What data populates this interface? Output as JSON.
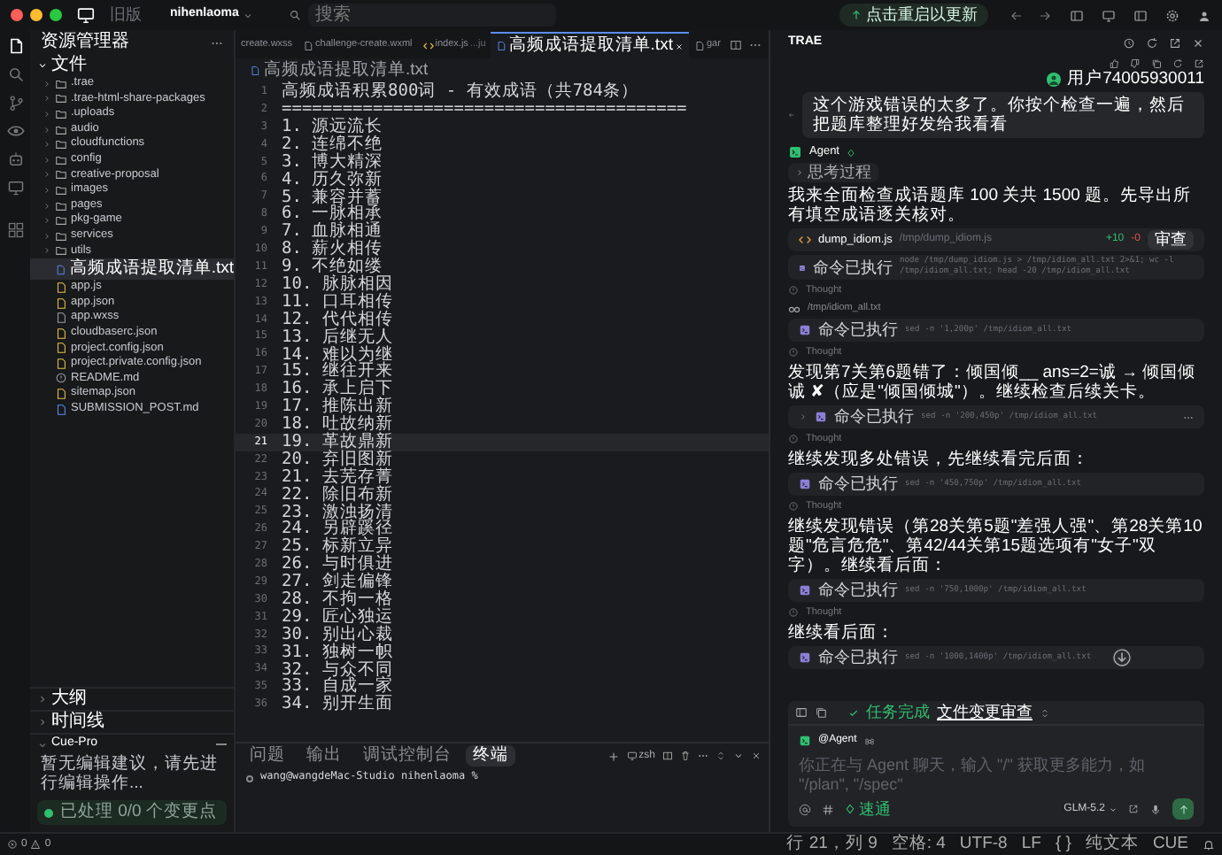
{
  "titlebar": {
    "badge": "旧版",
    "workspace": "nihenlaoma",
    "search_placeholder": "搜索",
    "update": "点击重启以更新"
  },
  "activity_bar": [
    {
      "kind": "files",
      "selected": true
    },
    {
      "kind": "search",
      "selected": false
    },
    {
      "kind": "branch",
      "selected": false
    },
    {
      "kind": "eye",
      "selected": false
    },
    {
      "kind": "robot",
      "selected": false
    },
    {
      "kind": "monitor",
      "selected": false
    },
    {
      "kind": "grid",
      "selected": false
    }
  ],
  "explorer": {
    "title": "资源管理器",
    "root": "文件",
    "items": [
      {
        "name": ".trae",
        "kind": "folder",
        "selected": false
      },
      {
        "name": ".trae-html-share-packages",
        "kind": "folder",
        "selected": false
      },
      {
        "name": ".uploads",
        "kind": "folder",
        "selected": false
      },
      {
        "name": "audio",
        "kind": "folder",
        "selected": false
      },
      {
        "name": "cloudfunctions",
        "kind": "folder",
        "selected": false
      },
      {
        "name": "config",
        "kind": "folder",
        "selected": false
      },
      {
        "name": "creative-proposal",
        "kind": "folder",
        "selected": false
      },
      {
        "name": "images",
        "kind": "folder",
        "selected": false
      },
      {
        "name": "pages",
        "kind": "folder",
        "selected": false
      },
      {
        "name": "pkg-game",
        "kind": "folder",
        "selected": false
      },
      {
        "name": "services",
        "kind": "folder",
        "selected": false
      },
      {
        "name": "utils",
        "kind": "folder",
        "selected": false
      },
      {
        "name": "高频成语提取清单.txt",
        "kind": "txt",
        "selected": true
      },
      {
        "name": "app.js",
        "kind": "js",
        "selected": false
      },
      {
        "name": "app.json",
        "kind": "json",
        "selected": false
      },
      {
        "name": "app.wxss",
        "kind": "wxss",
        "selected": false
      },
      {
        "name": "cloudbaserc.json",
        "kind": "json",
        "selected": false
      },
      {
        "name": "project.config.json",
        "kind": "json",
        "selected": false
      },
      {
        "name": "project.private.config.json",
        "kind": "json",
        "selected": false
      },
      {
        "name": "README.md",
        "kind": "info",
        "selected": false
      },
      {
        "name": "sitemap.json",
        "kind": "json",
        "selected": false
      },
      {
        "name": "SUBMISSION_POST.md",
        "kind": "md",
        "selected": false
      }
    ]
  },
  "side_panels": [
    {
      "label": "大纲",
      "expanded": false
    },
    {
      "label": "时间线",
      "expanded": false
    }
  ],
  "cue_pro": {
    "title": "Cue-Pro",
    "expanded": true,
    "message": "暂无编辑建议，请先进行编辑操作...",
    "status": "已处理 0/0 个变更点"
  },
  "editor": {
    "tabs": [
      {
        "label": "create.wxss",
        "selected": false
      },
      {
        "label": "challenge-create.wxml",
        "kind": "file",
        "selected": false
      },
      {
        "label": "index.js",
        "hint": "...ju",
        "kind": "js",
        "selected": false
      },
      {
        "label": "高频成语提取清单.txt",
        "kind": "txt",
        "selected": true
      },
      {
        "label": "gar",
        "kind": "file",
        "selected": false
      }
    ],
    "breadcrumb": "高频成语提取清单.txt",
    "lines": [
      {
        "number": "1",
        "text": "高频成语积累800词 - 有效成语（共784条）",
        "current": false
      },
      {
        "number": "2",
        "text": "========================================",
        "current": false
      },
      {
        "number": "3",
        "text": "1. 源远流长",
        "current": false
      },
      {
        "number": "4",
        "text": "2. 连绵不绝",
        "current": false
      },
      {
        "number": "5",
        "text": "3. 博大精深",
        "current": false
      },
      {
        "number": "6",
        "text": "4. 历久弥新",
        "current": false
      },
      {
        "number": "7",
        "text": "5. 兼容并蓄",
        "current": false
      },
      {
        "number": "8",
        "text": "6. 一脉相承",
        "current": false
      },
      {
        "number": "9",
        "text": "7. 血脉相通",
        "current": false
      },
      {
        "number": "10",
        "text": "8. 薪火相传",
        "current": false
      },
      {
        "number": "11",
        "text": "9. 不绝如缕",
        "current": false
      },
      {
        "number": "12",
        "text": "10. 脉脉相因",
        "current": false
      },
      {
        "number": "13",
        "text": "11. 口耳相传",
        "current": false
      },
      {
        "number": "14",
        "text": "12. 代代相传",
        "current": false
      },
      {
        "number": "15",
        "text": "13. 后继无人",
        "current": false
      },
      {
        "number": "16",
        "text": "14. 难以为继",
        "current": false
      },
      {
        "number": "17",
        "text": "15. 继往开来",
        "current": false
      },
      {
        "number": "18",
        "text": "16. 承上启下",
        "current": false
      },
      {
        "number": "19",
        "text": "17. 推陈出新",
        "current": false
      },
      {
        "number": "20",
        "text": "18. 吐故纳新",
        "current": false
      },
      {
        "number": "21",
        "text": "19. 革故鼎新",
        "current": true
      },
      {
        "number": "22",
        "text": "20. 弃旧图新",
        "current": false
      },
      {
        "number": "23",
        "text": "21. 去芜存菁",
        "current": false
      },
      {
        "number": "24",
        "text": "22. 除旧布新",
        "current": false
      },
      {
        "number": "25",
        "text": "23. 激浊扬清",
        "current": false
      },
      {
        "number": "26",
        "text": "24. 另辟蹊径",
        "current": false
      },
      {
        "number": "27",
        "text": "25. 标新立异",
        "current": false
      },
      {
        "number": "28",
        "text": "26. 与时俱进",
        "current": false
      },
      {
        "number": "29",
        "text": "27. 剑走偏锋",
        "current": false
      },
      {
        "number": "30",
        "text": "28. 不拘一格",
        "current": false
      },
      {
        "number": "31",
        "text": "29. 匠心独运",
        "current": false
      },
      {
        "number": "32",
        "text": "30. 别出心裁",
        "current": false
      },
      {
        "number": "33",
        "text": "31. 独树一帜",
        "current": false
      },
      {
        "number": "34",
        "text": "32. 与众不同",
        "current": false
      },
      {
        "number": "35",
        "text": "33. 自成一家",
        "current": false
      },
      {
        "number": "36",
        "text": "34. 别开生面",
        "current": false
      }
    ]
  },
  "panel": {
    "tabs": [
      {
        "label": "问题",
        "selected": false
      },
      {
        "label": "输出",
        "selected": false
      },
      {
        "label": "调试控制台",
        "selected": false
      },
      {
        "label": "终端",
        "selected": true
      }
    ],
    "shell": "zsh",
    "prompt": "wang@wangdeMac-Studio nihenlaoma %"
  },
  "chat": {
    "title": "TRAE",
    "user": "用户74005930011",
    "user_message": "这个游戏错误的太多了。你按个检查一遍，然后把题库整理好发给我看看",
    "agent": "Agent",
    "items": [
      {
        "kind": "toggle",
        "text": "思考过程"
      },
      {
        "kind": "text",
        "text": "我来全面检查成语题库 100 关共 1500 题。先导出所有填空成语逐关核对。"
      },
      {
        "kind": "file",
        "name": "dump_idiom.js",
        "path": "/tmp/dump_idiom.js",
        "added": "+10",
        "removed": "-0",
        "action": "审查"
      },
      {
        "kind": "command",
        "label": "命令已执行",
        "command": "node /tmp/dump_idiom.js > /tmp/idiom_all.txt 2>&1; wc -l /tmp/idiom_all.txt; head -20 /tmp/idiom_all.txt",
        "hovered": false
      },
      {
        "kind": "thought",
        "text": "Thought"
      },
      {
        "kind": "path",
        "text": "/tmp/idiom_all.txt"
      },
      {
        "kind": "command",
        "label": "命令已执行",
        "command": "sed -n '1,200p' /tmp/idiom_all.txt",
        "hovered": false
      },
      {
        "kind": "thought",
        "text": "Thought"
      },
      {
        "kind": "text",
        "text": "发现第7关第6题错了：倾国倾__ ans=2=诚 → 倾国倾诚 ✘（应是\"倾国倾城\"）。继续检查后续关卡。"
      },
      {
        "kind": "command",
        "label": "命令已执行",
        "command": "sed -n '200,450p' /tmp/idiom_all.txt",
        "hovered": true
      },
      {
        "kind": "thought",
        "text": "Thought"
      },
      {
        "kind": "text",
        "text": "继续发现多处错误，先继续看完后面："
      },
      {
        "kind": "command",
        "label": "命令已执行",
        "command": "sed -n '450,750p' /tmp/idiom_all.txt",
        "hovered": false
      },
      {
        "kind": "thought",
        "text": "Thought"
      },
      {
        "kind": "text",
        "text": "继续发现错误（第28关第5题\"差强人强\"、第28关第10题\"危言危危\"、第42/44关第15题选项有\"女子\"双字）。继续看后面："
      },
      {
        "kind": "command",
        "label": "命令已执行",
        "command": "sed -n '750,1000p' /tmp/idiom_all.txt",
        "hovered": false
      },
      {
        "kind": "thought",
        "text": "Thought"
      },
      {
        "kind": "text",
        "text": "继续看后面："
      },
      {
        "kind": "command",
        "label": "命令已执行",
        "command": "sed -n '1000,1400p' /tmp/idiom_all.txt",
        "hovered": false
      }
    ],
    "task_bar": {
      "status": "任务完成",
      "link": "文件变更审查"
    },
    "input": {
      "agent": "@Agent",
      "placeholder": "你正在与 Agent 聊天，输入 \"/\" 获取更多能力，如 \"/plan\", \"/spec\"",
      "mode": "速通",
      "model": "GLM-5.2"
    }
  },
  "status_bar": {
    "errors": "0",
    "warnings": "0",
    "items": [
      "行 21，列 9",
      "空格: 4",
      "UTF-8",
      "LF",
      "{ }",
      "纯文本",
      "CUE"
    ]
  }
}
